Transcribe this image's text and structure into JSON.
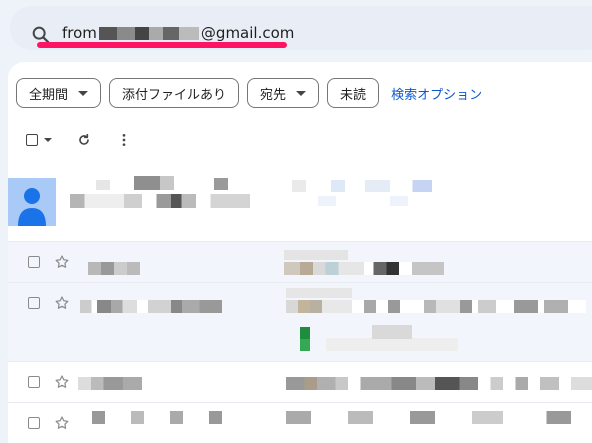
{
  "search": {
    "prefix": "from",
    "suffix": "@gmail.com"
  },
  "filters": [
    {
      "label": "全期間",
      "dropdown": true
    },
    {
      "label": "添付ファイルあり",
      "dropdown": false
    },
    {
      "label": "宛先",
      "dropdown": true
    },
    {
      "label": "未読",
      "dropdown": false
    }
  ],
  "search_options_link": "検索オプション",
  "icons": {
    "search": "search-icon",
    "refresh": "refresh-icon",
    "more": "more-vert-icon",
    "star": "star-icon",
    "avatar": "person-icon"
  },
  "colors": {
    "highlight": "#ff1464",
    "link": "#0b57d0",
    "avatar_bg": "#a9c9f6",
    "avatar_fg": "#1a73e8",
    "label_green": "#1e8e3e"
  }
}
